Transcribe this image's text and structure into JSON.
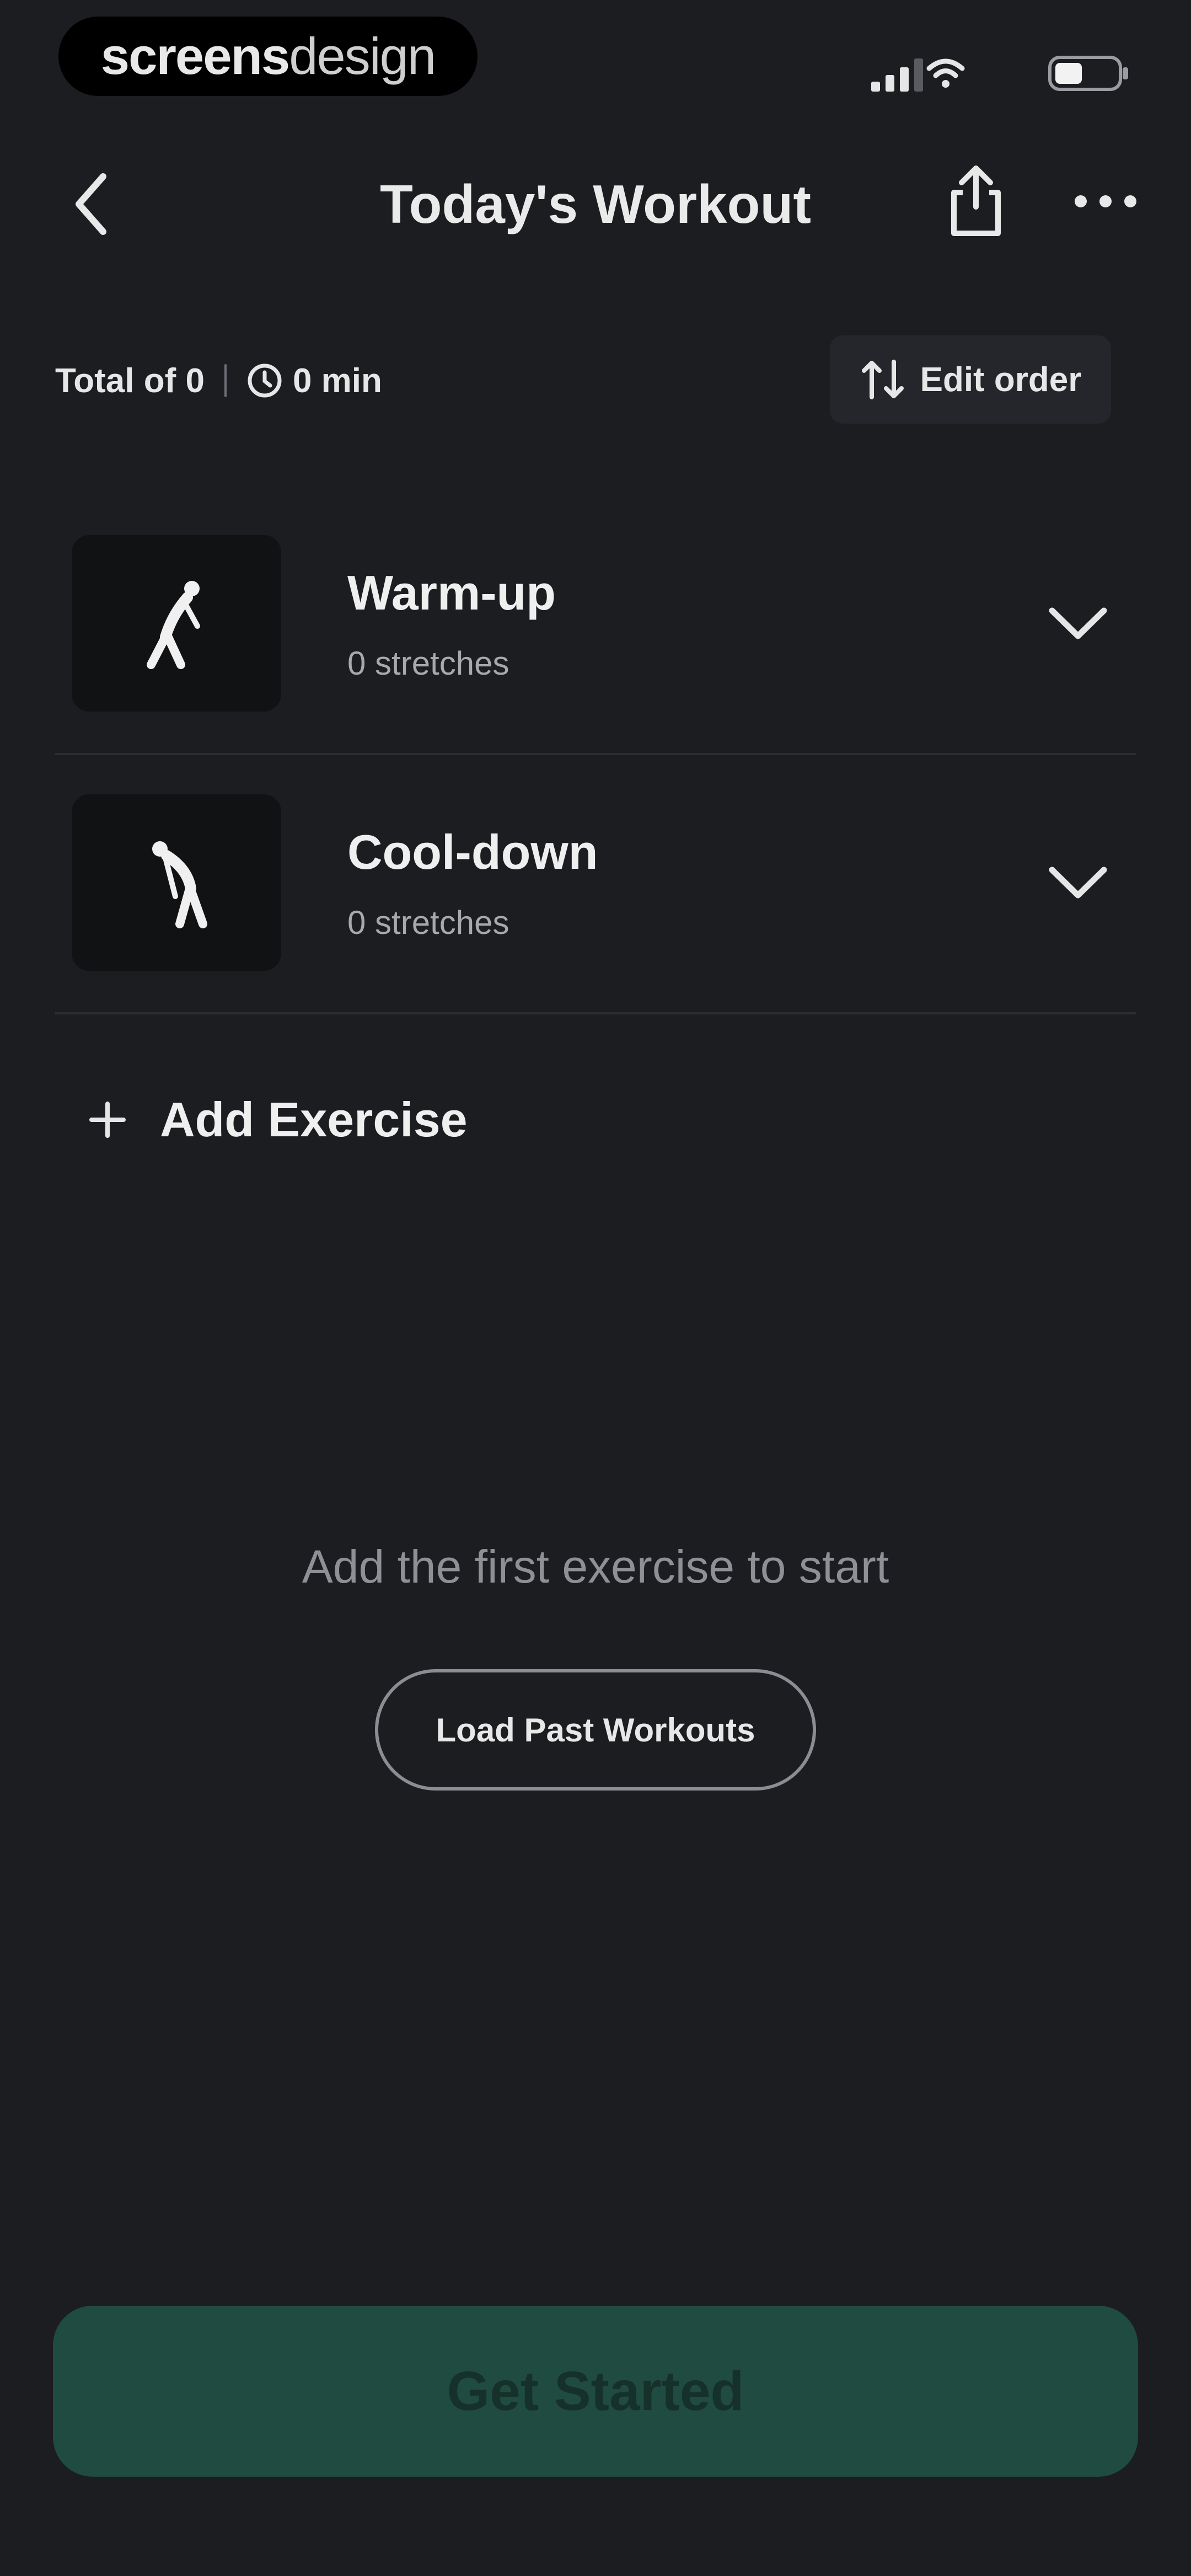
{
  "status_bar": {
    "brand_strong": "screens",
    "brand_light": "design",
    "icons": [
      "signal-icon",
      "wifi-icon",
      "battery-icon"
    ]
  },
  "header": {
    "title": "Today's Workout",
    "icons": {
      "back": "chevron-left-icon",
      "share": "share-icon",
      "more": "more-icon"
    }
  },
  "summary": {
    "total": "Total of 0",
    "time": "0 min",
    "edit_order": "Edit order"
  },
  "sections": [
    {
      "title": "Warm-up",
      "subtitle": "0 stretches"
    },
    {
      "title": "Cool-down",
      "subtitle": "0 stretches"
    }
  ],
  "actions": {
    "add_exercise": "Add Exercise",
    "empty_message": "Add the first exercise to start",
    "load_past": "Load Past Workouts",
    "get_started": "Get Started"
  },
  "colors": {
    "background": "#1c1d21",
    "cta_background": "#1f4b40",
    "cta_text": "#163129",
    "muted_text": "#8f9096"
  }
}
